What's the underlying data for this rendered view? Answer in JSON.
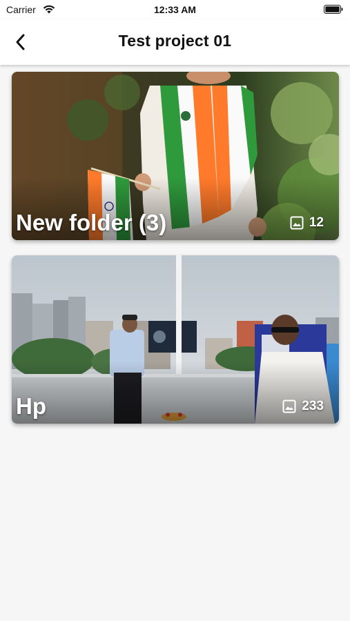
{
  "status_bar": {
    "carrier": "Carrier",
    "time": "12:33 AM"
  },
  "nav": {
    "title": "Test project 01",
    "back_icon": "chevron-left-icon"
  },
  "folders": [
    {
      "name": "New folder (3)",
      "image_count": "12",
      "count_icon": "image-icon"
    },
    {
      "name": "Hp",
      "image_count": "233",
      "count_icon": "image-icon"
    }
  ],
  "colors": {
    "background": "#f6f6f6",
    "nav_background": "#ffffff",
    "overlay_text": "#ffffff",
    "flag_saffron": "#ff7a2a",
    "flag_green": "#2f9a3c"
  }
}
